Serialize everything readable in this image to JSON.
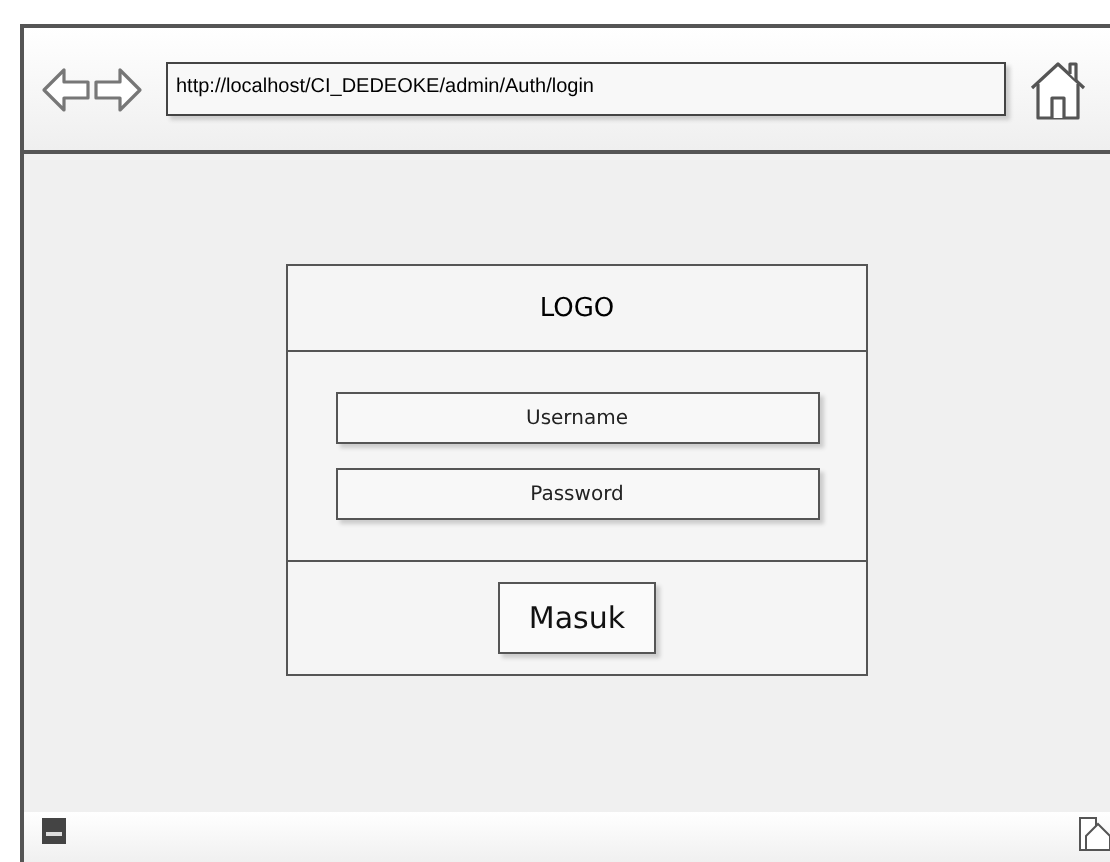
{
  "browser": {
    "url": "http://localhost/CI_DEDEOKE/admin/Auth/login"
  },
  "login": {
    "logo": "LOGO",
    "fields": [
      {
        "placeholder": "Username"
      },
      {
        "placeholder": "Password"
      }
    ],
    "button": "Masuk"
  }
}
